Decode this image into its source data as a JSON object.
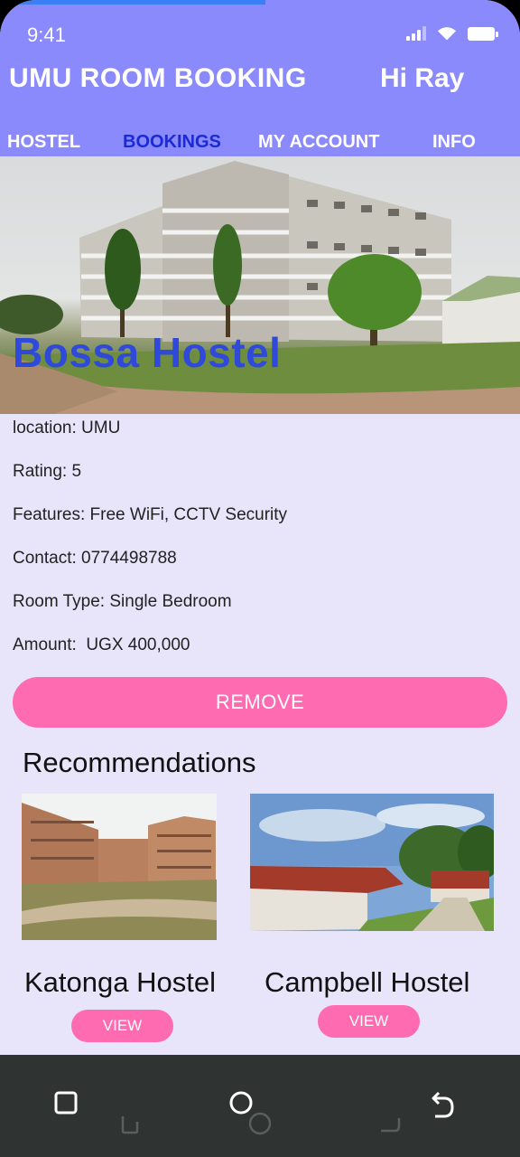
{
  "status_bar": {
    "time": "9:41"
  },
  "header": {
    "app_title": "UMU ROOM BOOKING",
    "greeting": "Hi Ray"
  },
  "tabs": [
    {
      "label": "HOSTEL"
    },
    {
      "label": "BOOKINGS"
    },
    {
      "label": "MY ACCOUNT"
    },
    {
      "label": "INFO"
    }
  ],
  "booking": {
    "hostel_name": "Bossa Hostel",
    "details": [
      "location: UMU",
      "Rating: 5",
      "Features: Free WiFi, CCTV Security",
      "Contact: 0774498788",
      "Room Type: Single Bedroom",
      "Amount:  UGX 400,000"
    ],
    "remove_label": "REMOVE"
  },
  "recommendations": {
    "heading": "Recommendations",
    "items": [
      {
        "name": "Katonga Hostel",
        "view_label": "VIEW"
      },
      {
        "name": "Campbell Hostel",
        "view_label": "VIEW"
      }
    ]
  },
  "colors": {
    "header_bg": "#8a8afc",
    "page_bg": "#e8e4fa",
    "accent_pink": "#ff6bb0",
    "active_tab": "#1a2bd6",
    "hero_title": "#2f4ad8",
    "nav_bar": "#2f3331"
  },
  "icons": {
    "nav": [
      "recent-apps-icon",
      "home-icon",
      "back-icon"
    ],
    "status": [
      "signal-icon",
      "wifi-icon",
      "battery-icon"
    ]
  }
}
